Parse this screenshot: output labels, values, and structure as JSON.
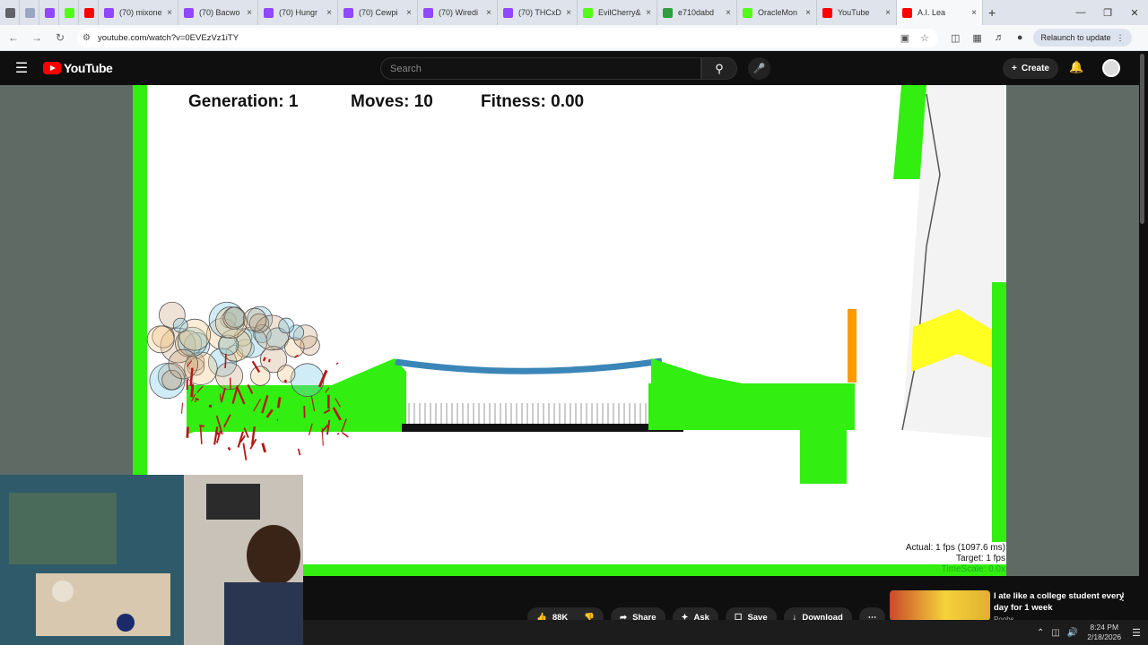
{
  "browser": {
    "tabs": [
      {
        "title": "",
        "fav": "#5f6368"
      },
      {
        "title": "",
        "fav": "#9aa6c2"
      },
      {
        "title": "",
        "fav": "#9146ff"
      },
      {
        "title": "",
        "fav": "#53fc18"
      },
      {
        "title": "",
        "fav": "#ff0000"
      },
      {
        "title": "(70) mixone",
        "fav": "#9146ff"
      },
      {
        "title": "(70) Bacwo",
        "fav": "#9146ff"
      },
      {
        "title": "(70) Hungr",
        "fav": "#9146ff"
      },
      {
        "title": "(70) Cewpi",
        "fav": "#9146ff"
      },
      {
        "title": "(70) Wiredi",
        "fav": "#9146ff"
      },
      {
        "title": "(70) THCxD",
        "fav": "#9146ff"
      },
      {
        "title": "EvilCherry&",
        "fav": "#53fc18"
      },
      {
        "title": "e710dabd",
        "fav": "#2e9e3e"
      },
      {
        "title": "OracleMon",
        "fav": "#53fc18"
      },
      {
        "title": "YouTube",
        "fav": "#ff0000"
      },
      {
        "title": "A.I. Lea",
        "fav": "#ff0000"
      }
    ],
    "new_tab": "+",
    "url": "youtube.com/watch?v=0EVEzVz1iTY",
    "relaunch": "Relaunch to update"
  },
  "youtube": {
    "logo": "YouTube",
    "search_placeholder": "Search",
    "create": "Create",
    "actions": {
      "likes": "88K",
      "share": "Share",
      "ask": "Ask",
      "save": "Save",
      "download": "Download"
    },
    "suggested": {
      "title": "I ate like a college student every day for 1 week",
      "sub": "Poobs"
    }
  },
  "sim": {
    "generation": "Generation: 1",
    "moves": "Moves: 10",
    "fitness": "Fitness: 0.00",
    "actual": "Actual: 1 fps (1097.6 ms)",
    "target": "Target: 1 fps",
    "timescale": "TimeScale: 0.0x"
  },
  "taskbar": {
    "time": "8:24 PM",
    "date": "2/18/2026"
  },
  "colors": {
    "ground": "#33ee11",
    "bridge": "#3b86b8",
    "wall": "#ff9a00",
    "yellow": "#ffff22"
  }
}
